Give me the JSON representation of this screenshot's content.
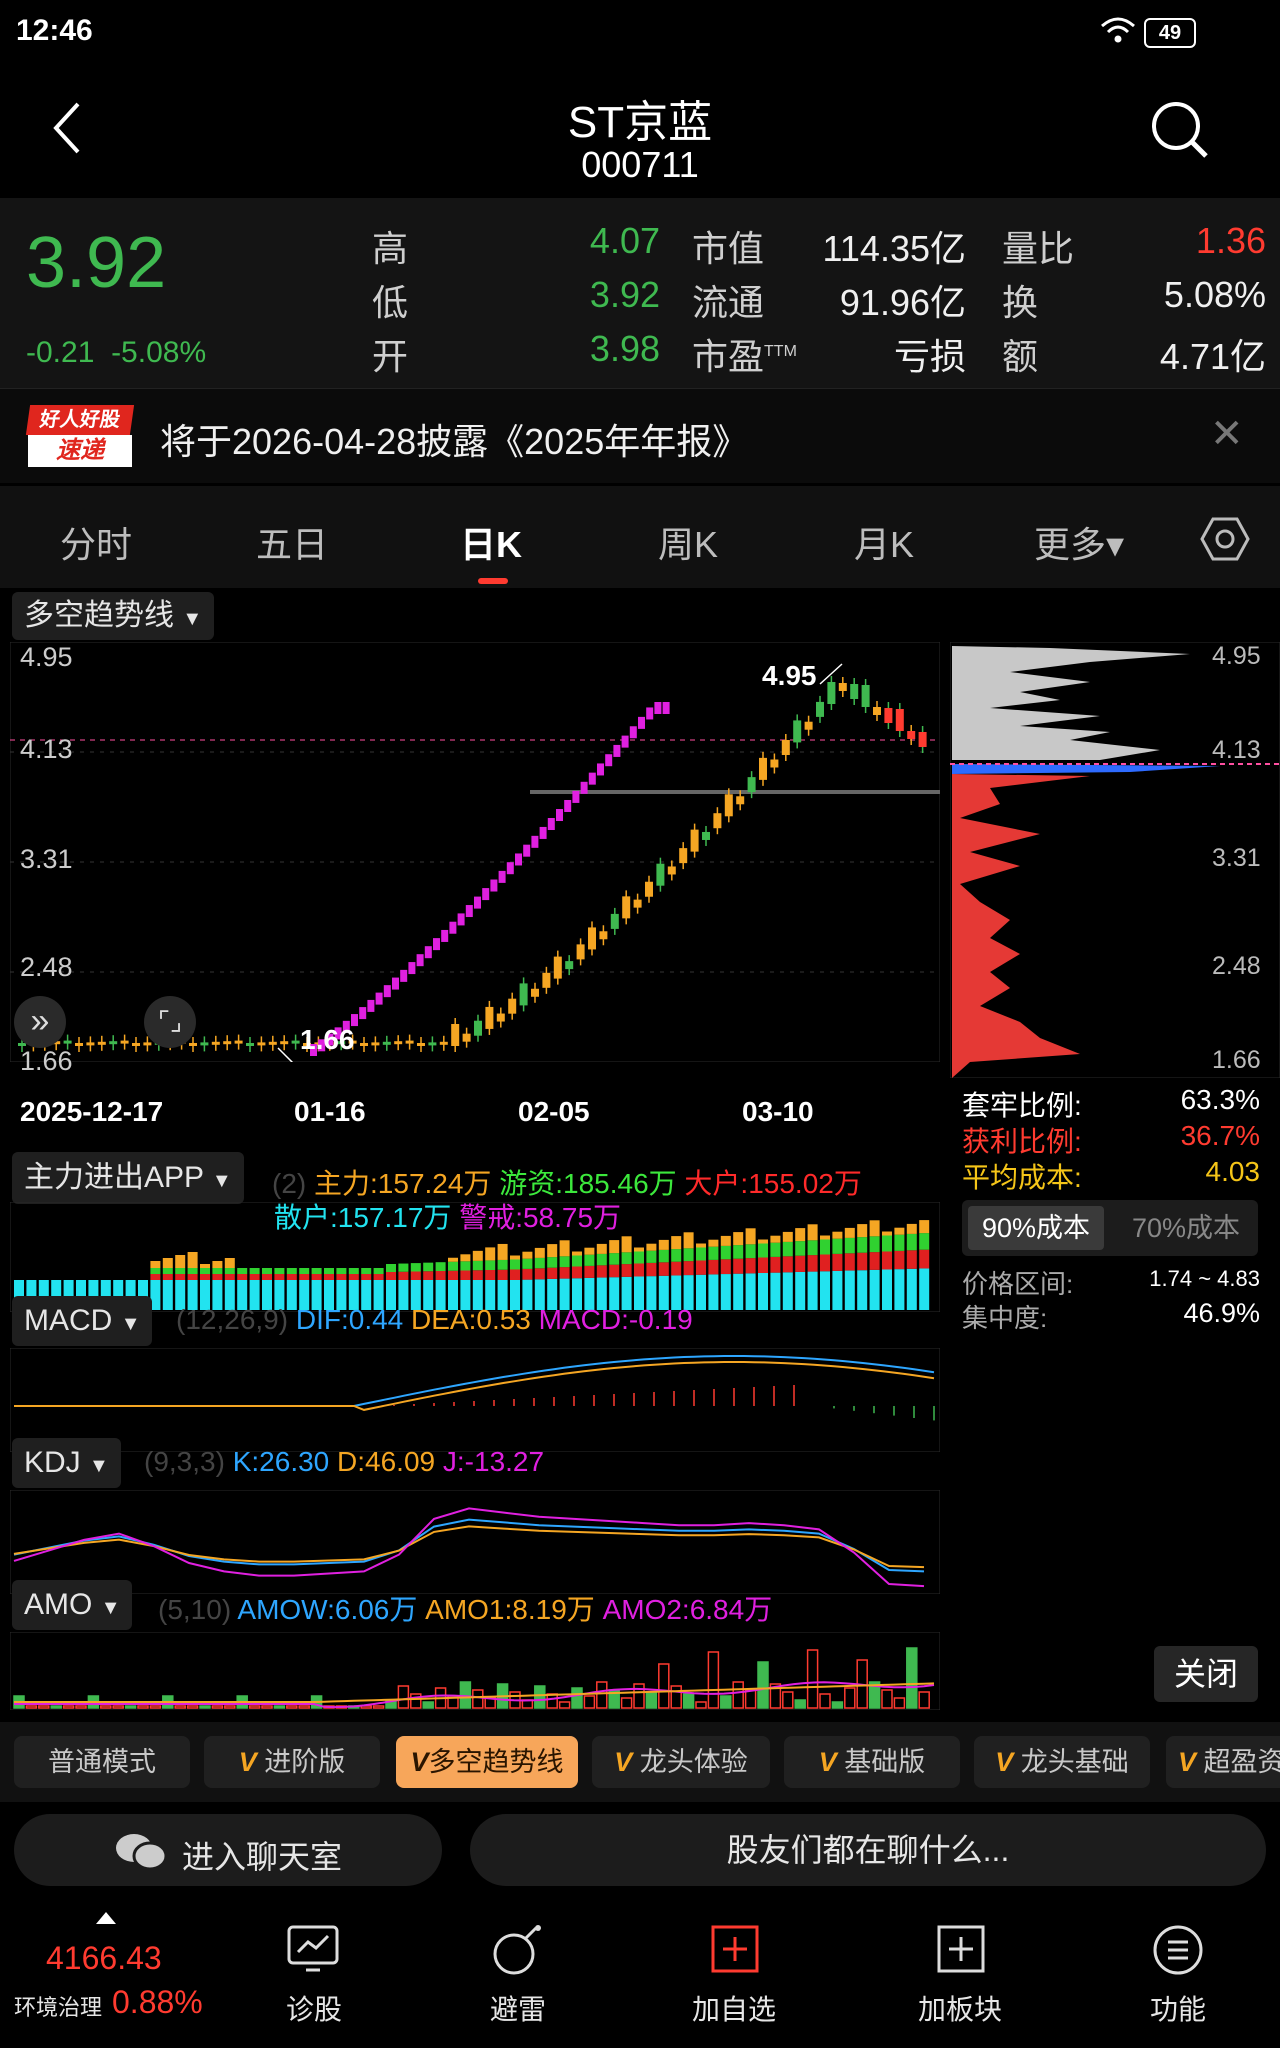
{
  "status": {
    "time": "12:46",
    "battery": "49"
  },
  "header": {
    "stock_name": "ST京蓝",
    "stock_code": "000711"
  },
  "quote": {
    "price": "3.92",
    "change": "-0.21",
    "change_pct": "-5.08%",
    "fields": [
      {
        "label": "高",
        "value": "4.07"
      },
      {
        "label": "低",
        "value": "3.92"
      },
      {
        "label": "开",
        "value": "3.98"
      },
      {
        "label": "市值",
        "value": "114.35亿"
      },
      {
        "label": "流通",
        "value": "91.96亿"
      },
      {
        "label": "市盈",
        "sup": "TTM",
        "value": "亏损"
      },
      {
        "label": "量比",
        "value": "1.36"
      },
      {
        "label": "换",
        "value": "5.08%"
      },
      {
        "label": "额",
        "value": "4.71亿"
      }
    ]
  },
  "notice": {
    "badge_top": "好人好股",
    "badge_bottom": "速递",
    "text": "将于2026-04-28披露《2025年年报》"
  },
  "tabs": [
    {
      "label": "分时"
    },
    {
      "label": "五日"
    },
    {
      "label": "日K",
      "active": true
    },
    {
      "label": "周K"
    },
    {
      "label": "月K"
    },
    {
      "label": "更多▾"
    }
  ],
  "kline": {
    "indicator": "多空趋势线",
    "y_ticks": [
      "4.95",
      "4.13",
      "3.31",
      "2.48",
      "1.66"
    ],
    "x_ticks": [
      "2025-12-17",
      "01-16",
      "02-05",
      "03-10"
    ],
    "high_label": "4.95",
    "low_label": "1.66"
  },
  "chip": {
    "y_ticks": [
      "4.95",
      "4.13",
      "3.31",
      "2.48",
      "1.66"
    ],
    "trapped_label": "套牢比例:",
    "trapped_value": "63.3%",
    "profit_label": "获利比例:",
    "profit_value": "36.7%",
    "avg_label": "平均成本:",
    "avg_value": "4.03",
    "tab_90": "90%成本",
    "tab_70": "70%成本",
    "range_label": "价格区间:",
    "range_value": "1.74 ~ 4.83",
    "conc_label": "集中度:",
    "conc_value": "46.9%",
    "close_label": "关闭"
  },
  "ind1": {
    "name": "主力进出APP",
    "param": "(2)",
    "main_force": "主力:157.24万",
    "hot_money": "游资:185.46万",
    "big": "大户:155.02万",
    "retail": "散户:157.17万",
    "alert": "警戒:58.75万"
  },
  "ind2": {
    "name": "MACD",
    "param": "(12,26,9)",
    "dif": "DIF:0.44",
    "dea": "DEA:0.53",
    "macd": "MACD:-0.19"
  },
  "ind3": {
    "name": "KDJ",
    "param": "(9,3,3)",
    "k": "K:26.30",
    "d": "D:46.09",
    "j": "J:-13.27"
  },
  "ind4": {
    "name": "AMO",
    "param": "(5,10)",
    "amow": "AMOW:6.06万",
    "amo1": "AMO1:8.19万",
    "amo2": "AMO2:6.84万"
  },
  "modes": [
    "普通模式",
    "进阶版",
    "多空趋势线",
    "龙头体验",
    "基础版",
    "龙头基础",
    "超盈资"
  ],
  "chat": {
    "enter": "进入聊天室",
    "prompt": "股友们都在聊什么..."
  },
  "index": {
    "value": "4166.43",
    "name": "环境治理",
    "pct": "0.88%"
  },
  "nav": [
    {
      "label": "诊股",
      "icon": "diagnose-icon"
    },
    {
      "label": "避雷",
      "icon": "bomb-icon"
    },
    {
      "label": "加自选",
      "icon": "add-watchlist-icon"
    },
    {
      "label": "加板块",
      "icon": "add-sector-icon"
    },
    {
      "label": "功能",
      "icon": "menu-icon"
    }
  ],
  "colors": {
    "up": "#ff3b30",
    "down": "#3fb950",
    "accent_orange": "#f5a623",
    "magenta": "#e020e0",
    "cyan": "#22e3f0"
  }
}
